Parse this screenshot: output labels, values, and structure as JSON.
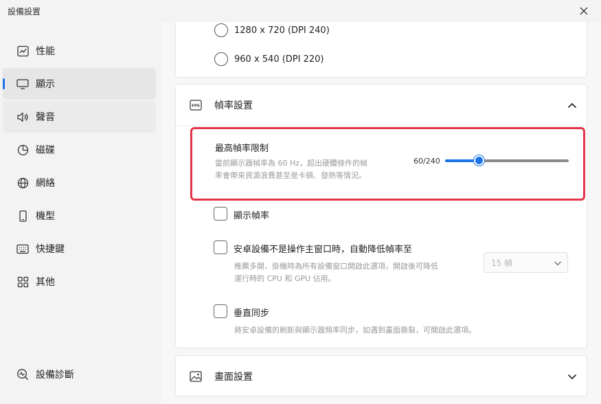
{
  "window": {
    "title": "設備設置"
  },
  "sidebar": {
    "items": [
      {
        "label": "性能",
        "icon": "performance-chart-icon"
      },
      {
        "label": "顯示",
        "icon": "monitor-icon"
      },
      {
        "label": "聲音",
        "icon": "speaker-icon"
      },
      {
        "label": "磁碟",
        "icon": "disk-pie-icon"
      },
      {
        "label": "網絡",
        "icon": "globe-icon"
      },
      {
        "label": "機型",
        "icon": "phone-icon"
      },
      {
        "label": "快捷鍵",
        "icon": "keyboard-icon"
      },
      {
        "label": "其他",
        "icon": "grid-icon"
      }
    ],
    "active_index": 1,
    "diagnostics": {
      "label": "設備診斷",
      "icon": "diagnostics-search-icon"
    }
  },
  "resolution": {
    "options": [
      {
        "label": "1280 x 720 (DPI 240)",
        "selected": false
      },
      {
        "label": "960 x 540 (DPI 220)",
        "selected": false
      }
    ]
  },
  "fps_section": {
    "icon_text": "FPS",
    "header": "幀率設置",
    "max_fps": {
      "title": "最高幀率限制",
      "desc_line1": "當前顯示器幀率為 60 Hz，超出硬體條件的幀",
      "desc_line2": "率會帶來資源浪費甚至是卡頓、發熱等情況。",
      "value_text": "60/240",
      "value": 60,
      "max": 240
    },
    "show_fps": {
      "label": "顯示幀率",
      "checked": false
    },
    "auto_reduce": {
      "label": "安卓設備不是操作主窗口時，自動降低幀率至",
      "desc_line1": "推薦多開、掛機時為所有設備窗口開啟此選項，開啟後可降低",
      "desc_line2": "運行時的 CPU 和 GPU 佔用。",
      "checked": false,
      "select_value": "15 幀"
    },
    "vsync": {
      "label": "垂直同步",
      "desc": "將安卓設備的刷新與顯示器頻率同步，如遇到畫面撕裂，可開啟此選項。",
      "checked": false
    }
  },
  "display_section": {
    "header": "畫面設置"
  },
  "colors": {
    "accent": "#1a73e8",
    "highlight": "#e53347"
  }
}
